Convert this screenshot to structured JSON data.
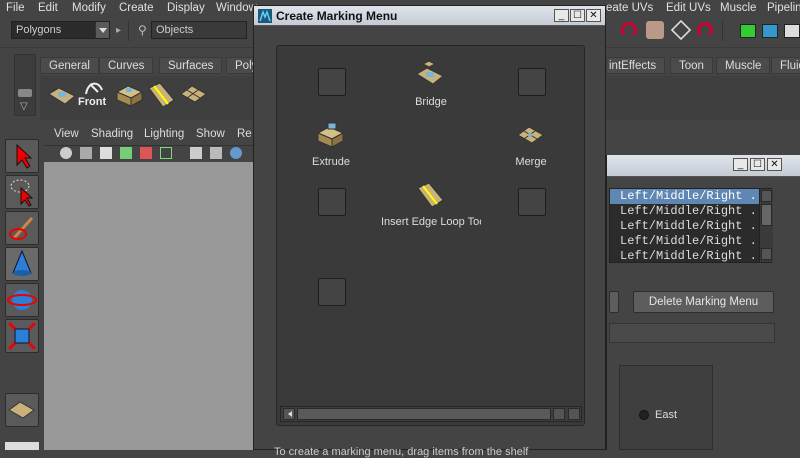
{
  "menubar": {
    "items": [
      "File",
      "Edit",
      "Modify",
      "Create",
      "Display",
      "Window",
      "eate UVs",
      "Edit UVs",
      "Muscle",
      "Pipeline"
    ]
  },
  "statusline": {
    "mode": "Polygons",
    "objects_label": "Objects"
  },
  "shelf": {
    "tabs": [
      "General",
      "Curves",
      "Surfaces",
      "Poly",
      "intEffects",
      "Toon",
      "Muscle",
      "Fluid"
    ],
    "front_label": "Front"
  },
  "panel": {
    "menus": [
      "View",
      "Shading",
      "Lighting",
      "Show",
      "Re"
    ]
  },
  "dialog": {
    "title": "Create Marking Menu",
    "buttons": {
      "minimize": "_",
      "maximize": "☐",
      "close": "✕"
    },
    "items": {
      "bridge": "Bridge",
      "extrude": "Extrude",
      "merge": "Merge",
      "insert_edge_loop": "Insert Edge Loop Too"
    },
    "bottom_text": "To create a marking menu, drag items from the shelf"
  },
  "dialog2": {
    "list_items": [
      "Left/Middle/Right ...",
      "Left/Middle/Right ...",
      "Left/Middle/Right ...",
      "Left/Middle/Right ...",
      "Left/Middle/Right ..."
    ],
    "delete_button": "Delete Marking Menu",
    "east_label": "East"
  },
  "colors": {
    "title_gradient_top": "#dfe4ea",
    "selection": "#5f87b3",
    "viewport": "#999999"
  }
}
